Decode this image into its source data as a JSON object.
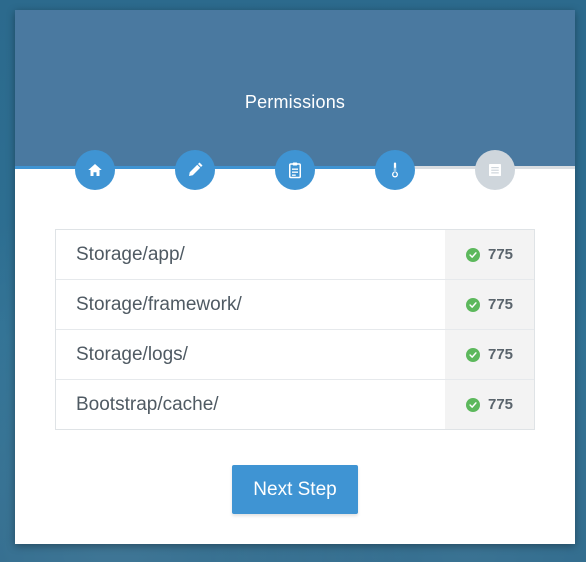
{
  "header": {
    "title": "Permissions"
  },
  "steps": [
    {
      "name": "home",
      "icon": "home-icon",
      "state": "complete"
    },
    {
      "name": "edit",
      "icon": "pencil-icon",
      "state": "complete"
    },
    {
      "name": "requirements",
      "icon": "clipboard-icon",
      "state": "complete"
    },
    {
      "name": "permissions",
      "icon": "thermometer-icon",
      "state": "active"
    },
    {
      "name": "environment",
      "icon": "document-icon",
      "state": "pending"
    }
  ],
  "permissions": {
    "rows": [
      {
        "folder": "Storage/app/",
        "permission": "775",
        "status": "ok"
      },
      {
        "folder": "Storage/framework/",
        "permission": "775",
        "status": "ok"
      },
      {
        "folder": "Storage/logs/",
        "permission": "775",
        "status": "ok"
      },
      {
        "folder": "Bootstrap/cache/",
        "permission": "775",
        "status": "ok"
      }
    ]
  },
  "actions": {
    "next_label": "Next Step"
  },
  "colors": {
    "header": "#4a79a0",
    "accent": "#3f94d3",
    "success": "#5cb85c",
    "inactive_step": "#cfd6dc"
  }
}
